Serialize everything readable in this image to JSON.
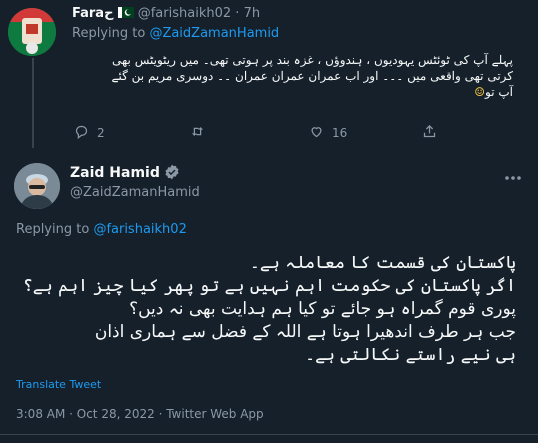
{
  "reply_tweet": {
    "display_name": "Faraح",
    "flag_icon": "pakistan-flag",
    "handle": "@farishaikh02",
    "separator": "·",
    "time_ago": "7h",
    "replying_prefix": "Replying to",
    "replying_handle": "@ZaidZamanHamid",
    "text_lines": [
      "پہلے آپ کی ٹوئٹس یہودیوں ، ہندوؤں ، غزہ بند پر ہوتی تھی۔ میں ریٹویٹس بھی",
      "کرتی تھی واقعی میں ۔۔۔ اور اب عمران عمران عمران ۔۔ دوسری مریم بن گئے",
      "آپ تو"
    ],
    "emoji": "☺",
    "reply_count": "2",
    "retweet_count": "",
    "like_count": "16"
  },
  "main_tweet": {
    "display_name": "Zaid Hamid",
    "verified_icon": "verified-badge",
    "handle": "@ZaidZamanHamid",
    "replying_prefix": "Replying to",
    "replying_handle": "@farishaikh02",
    "text_lines": [
      "پاکستان کی قسمت کا معاملہ ہے۔",
      "اگر پاکستان کی حکومت اہم نہیں ہے تو پھر کیا چیز اہم ہے؟",
      "پوری قوم گمراہ ہو جائے تو کیا ہم ہدایت بھی نہ دیں؟",
      "جب ہر طرف اندھیرا ہوتا ہے اللہ کے فضل سے ہماری اذان",
      "ہی نیے راستے نکالتی ہے۔"
    ],
    "translate_label": "Translate Tweet",
    "timestamp": "3:08 AM · Oct 28, 2022 · Twitter Web App"
  },
  "colors": {
    "background": "#15202b",
    "text": "#f7f9f9",
    "muted": "#8b98a5",
    "link": "#1d9bf0",
    "line": "#38444d"
  }
}
